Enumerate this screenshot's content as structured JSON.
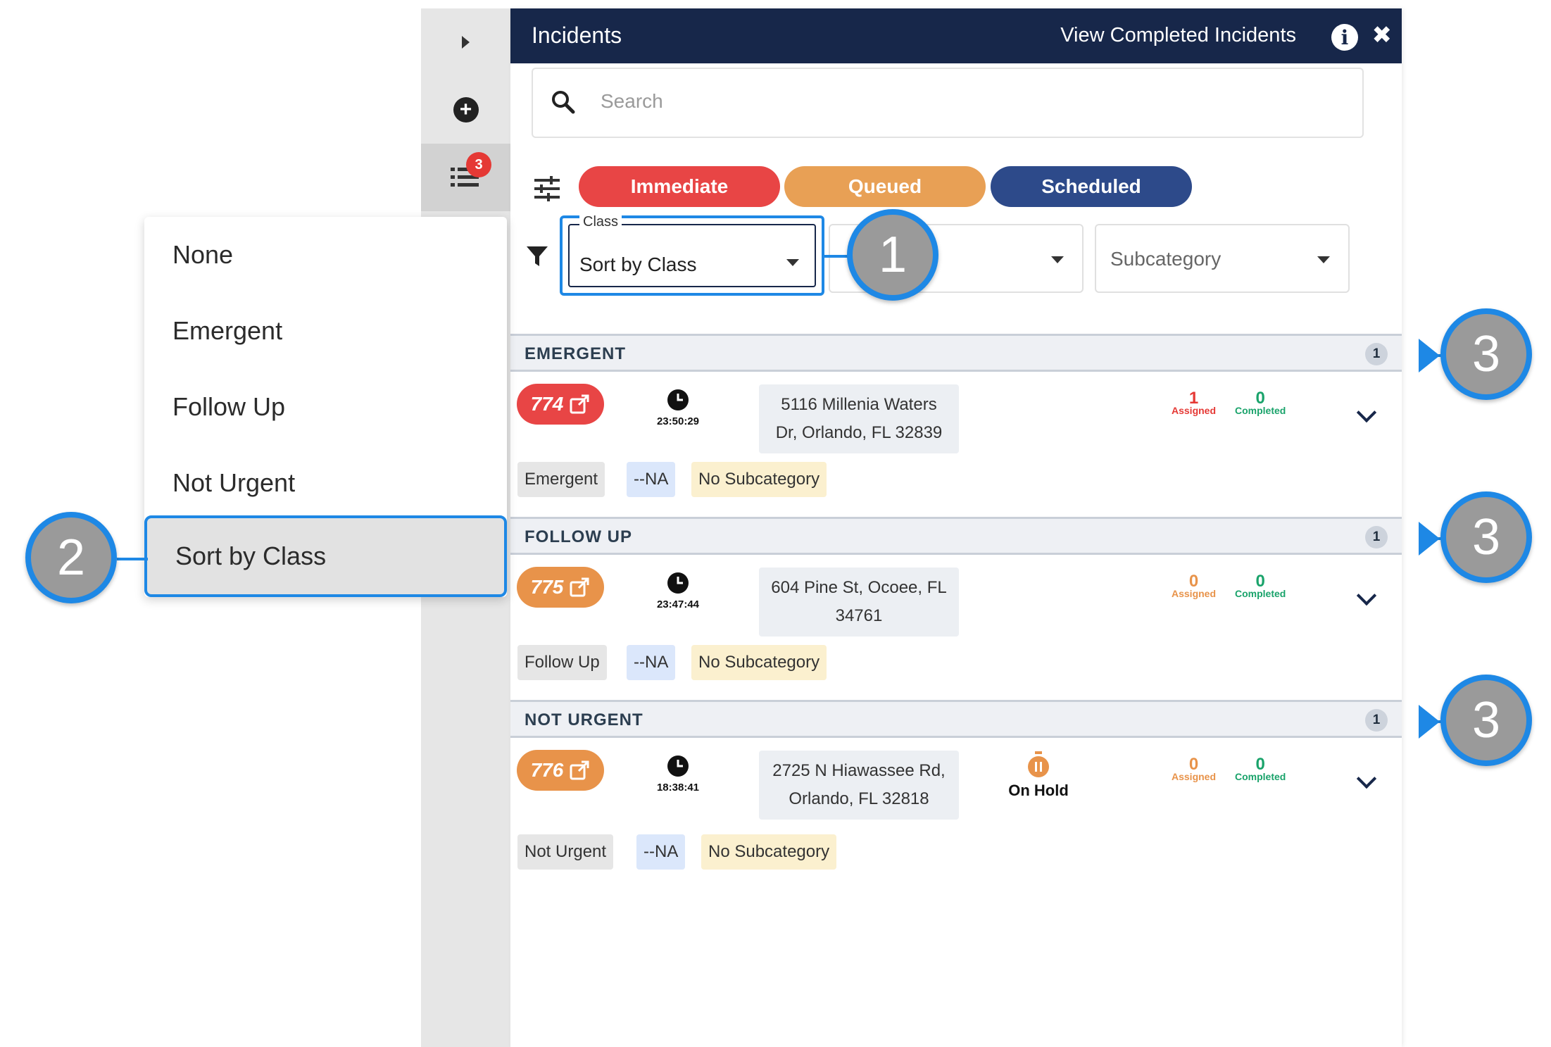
{
  "header": {
    "title": "Incidents",
    "view_completed": "View Completed Incidents"
  },
  "sidebar": {
    "list_badge": "3"
  },
  "search": {
    "placeholder": "Search"
  },
  "status_pills": {
    "immediate": "Immediate",
    "queued": "Queued",
    "scheduled": "Scheduled"
  },
  "filters": {
    "class_legend": "Class",
    "class_value": "Sort by Class",
    "subcategory_placeholder": "Subcategory"
  },
  "menu": {
    "items": [
      "None",
      "Emergent",
      "Follow Up",
      "Not Urgent",
      "Sort by Class"
    ],
    "selected": "Sort by Class"
  },
  "sections": [
    {
      "title": "EMERGENT",
      "count": "1",
      "incident": {
        "number": "774",
        "number_color": "#e84545",
        "time": "23:50:29",
        "address_line1": "5116 Millenia Waters",
        "address_line2": "Dr, Orlando, FL 32839",
        "assigned_count": "1",
        "assigned_label": "Assigned",
        "completed_count": "0",
        "completed_label": "Completed",
        "status": "",
        "tags": [
          "Emergent",
          "--NA",
          "No Subcategory"
        ]
      }
    },
    {
      "title": "FOLLOW UP",
      "count": "1",
      "incident": {
        "number": "775",
        "number_color": "#e8934a",
        "time": "23:47:44",
        "address_line1": "604 Pine St, Ocoee, FL",
        "address_line2": "34761",
        "assigned_count": "0",
        "assigned_label": "Assigned",
        "completed_count": "0",
        "completed_label": "Completed",
        "status": "",
        "tags": [
          "Follow Up",
          "--NA",
          "No Subcategory"
        ]
      }
    },
    {
      "title": "NOT URGENT",
      "count": "1",
      "incident": {
        "number": "776",
        "number_color": "#e8934a",
        "time": "18:38:41",
        "address_line1": "2725 N Hiawassee Rd,",
        "address_line2": "Orlando, FL 32818",
        "assigned_count": "0",
        "assigned_label": "Assigned",
        "completed_count": "0",
        "completed_label": "Completed",
        "status": "On Hold",
        "tags": [
          "Not Urgent",
          "--NA",
          "No Subcategory"
        ]
      }
    }
  ],
  "callouts": [
    "1",
    "2",
    "3",
    "3",
    "3"
  ],
  "colors": {
    "header_bg": "#17274a",
    "immediate": "#e84545",
    "queued": "#e8a055",
    "scheduled": "#2d4a8a",
    "accent": "#1e88e5",
    "assigned": "#e53935",
    "completed": "#1aa36b"
  }
}
